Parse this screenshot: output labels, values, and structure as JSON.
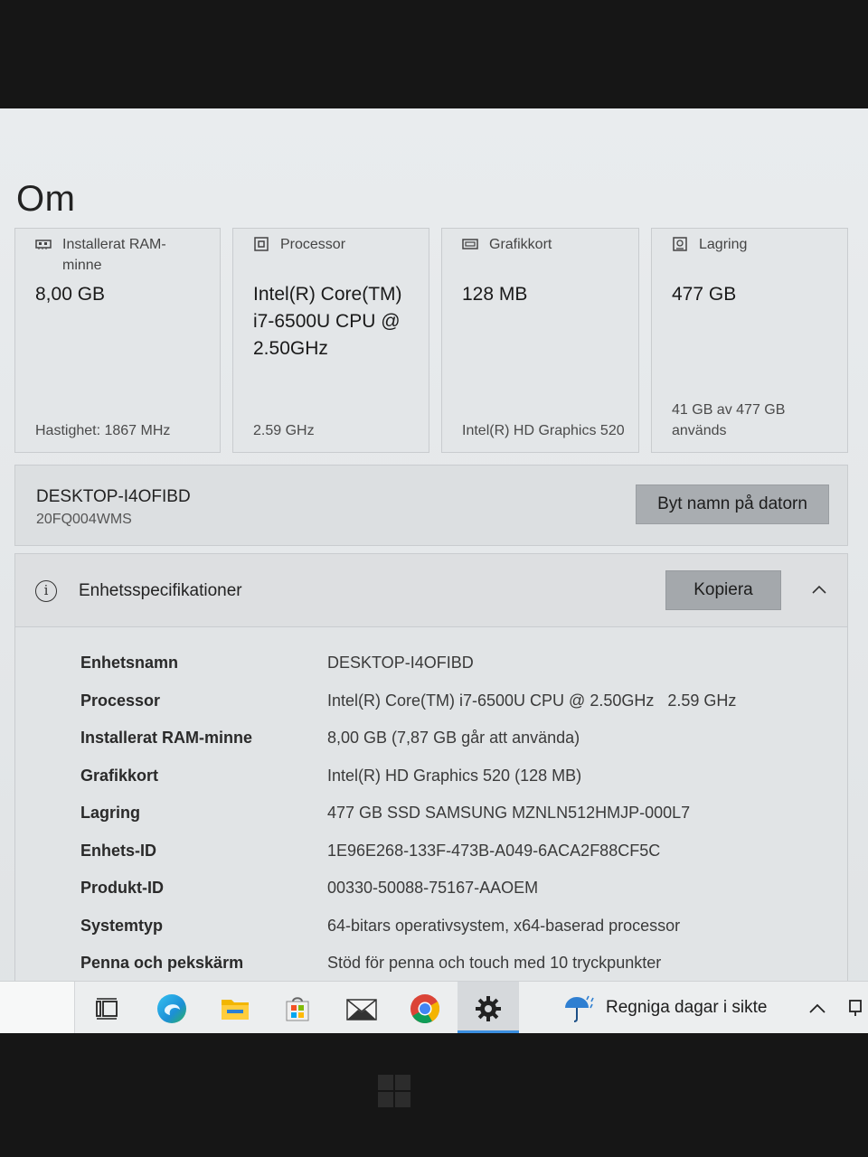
{
  "page": {
    "title": "Om"
  },
  "cards": [
    {
      "icon": "ram-icon",
      "label": "Installerat RAM-minne",
      "value": "8,00 GB",
      "sub": "Hastighet: 1867 MHz"
    },
    {
      "icon": "processor-icon",
      "label": "Processor",
      "value": "Intel(R) Core(TM) i7-6500U CPU @ 2.50GHz",
      "sub": "2.59 GHz"
    },
    {
      "icon": "graphics-card-icon",
      "label": "Grafikkort",
      "value": "128 MB",
      "sub": "Intel(R) HD Graphics 520"
    },
    {
      "icon": "storage-icon",
      "label": "Lagring",
      "value": "477 GB",
      "sub": "41 GB av 477 GB används"
    }
  ],
  "device": {
    "name": "DESKTOP-I4OFIBD",
    "model": "20FQ004WMS",
    "rename_label": "Byt namn på datorn"
  },
  "specs": {
    "title": "Enhetsspecifikationer",
    "copy_label": "Kopiera",
    "rows": [
      {
        "key": "Enhetsnamn",
        "value": "DESKTOP-I4OFIBD"
      },
      {
        "key": "Processor",
        "value": "Intel(R) Core(TM) i7-6500U CPU @ 2.50GHz   2.59 GHz"
      },
      {
        "key": "Installerat RAM-minne",
        "value": "8,00 GB (7,87 GB går att använda)"
      },
      {
        "key": "Grafikkort",
        "value": "Intel(R) HD Graphics 520 (128 MB)"
      },
      {
        "key": "Lagring",
        "value": "477 GB SSD SAMSUNG MZNLN512HMJP-000L7"
      },
      {
        "key": "Enhets-ID",
        "value": "1E96E268-133F-473B-A049-6ACA2F88CF5C"
      },
      {
        "key": "Produkt-ID",
        "value": "00330-50088-75167-AAOEM"
      },
      {
        "key": "Systemtyp",
        "value": "64-bitars operativsystem, x64-baserad processor"
      },
      {
        "key": "Penna och pekskärm",
        "value": "Stöd för penna och touch med 10 tryckpunkter"
      }
    ]
  },
  "taskbar": {
    "apps": [
      "task-view-icon",
      "edge-icon",
      "file-explorer-icon",
      "store-icon",
      "mail-icon",
      "chrome-icon",
      "settings-icon"
    ],
    "active_app": "settings-icon",
    "weather_text": "Regniga dagar i sikte",
    "colors": {
      "accent": "#3b8ee0",
      "edge": "#1c8fd6",
      "chrome_red": "#db4437",
      "chrome_yellow": "#f4b400",
      "chrome_green": "#0f9d58",
      "chrome_blue": "#4285f4"
    }
  }
}
